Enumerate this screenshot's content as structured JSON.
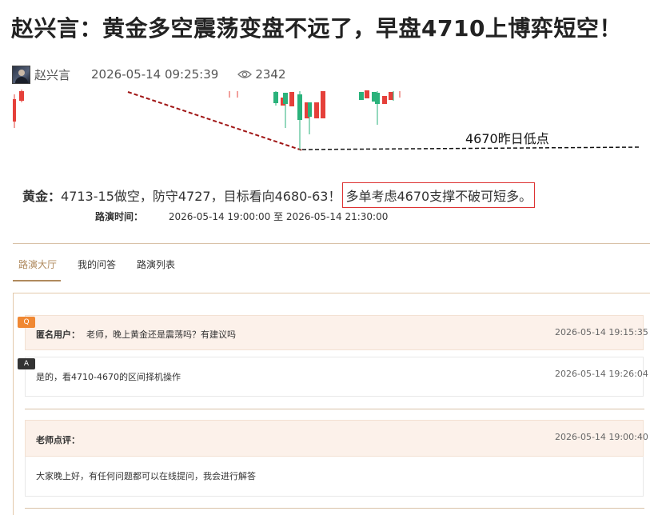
{
  "article": {
    "title": "赵兴言：黄金多空震荡变盘不远了，早盘4710上博弈短空！",
    "author": "赵兴言",
    "date": "2026-05-14 09:25:39",
    "views": "2342"
  },
  "chart": {
    "annotation": "4670昨日低点",
    "colors": {
      "up": "#e5403a",
      "down": "#2ab27b",
      "trend": "#a01515"
    }
  },
  "strategy": {
    "label": "黄金：",
    "text": "4713-15做空，防守4727，目标看向4680-63！",
    "highlight": "多单考虑4670支撑不破可短多。"
  },
  "roadshow": {
    "time_label": "路演时间：",
    "time_value": "2026-05-14 19:00:00 至 2026-05-14 21:30:00"
  },
  "tabs": [
    {
      "label": "路演大厅",
      "active": true
    },
    {
      "label": "我的问答",
      "active": false
    },
    {
      "label": "路演列表",
      "active": false
    }
  ],
  "qa": {
    "q_badge": "Q",
    "a_badge": "A",
    "question_user": "匿名用户：",
    "question_text": "老师，晚上黄金还是震荡吗？有建议吗",
    "question_time": "2026-05-14 19:15:35",
    "answer_text": "是的，看4710-4670的区间择机操作",
    "answer_time": "2026-05-14 19:26:04"
  },
  "comment": {
    "title": "老师点评：",
    "time": "2026-05-14 19:00:40",
    "body": "大家晚上好，有任何问题都可以在线提问，我会进行解答"
  }
}
